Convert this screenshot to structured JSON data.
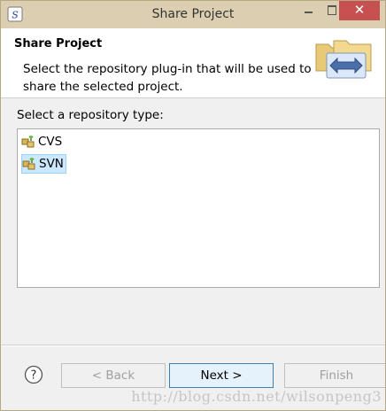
{
  "window": {
    "title": "Share Project",
    "controls": {
      "minimize": "minimize",
      "maximize": "maximize",
      "close": "✕"
    }
  },
  "header": {
    "title": "Share Project",
    "description": "Select the repository plug-in that will be used to share the selected project."
  },
  "main": {
    "prompt": "Select a repository type:",
    "repository_types": [
      {
        "label": "CVS",
        "selected": false,
        "icon": "repository-icon"
      },
      {
        "label": "SVN",
        "selected": true,
        "icon": "repository-icon"
      }
    ]
  },
  "buttons": {
    "help_icon": "?",
    "back": "< Back",
    "next": "Next >",
    "finish": "Finish"
  },
  "watermark": "http://blog.csdn.net/wilsonpeng3",
  "colors": {
    "titlebar": "#dccfb1",
    "close_button": "#c75050",
    "selection": "#cce8ff"
  }
}
